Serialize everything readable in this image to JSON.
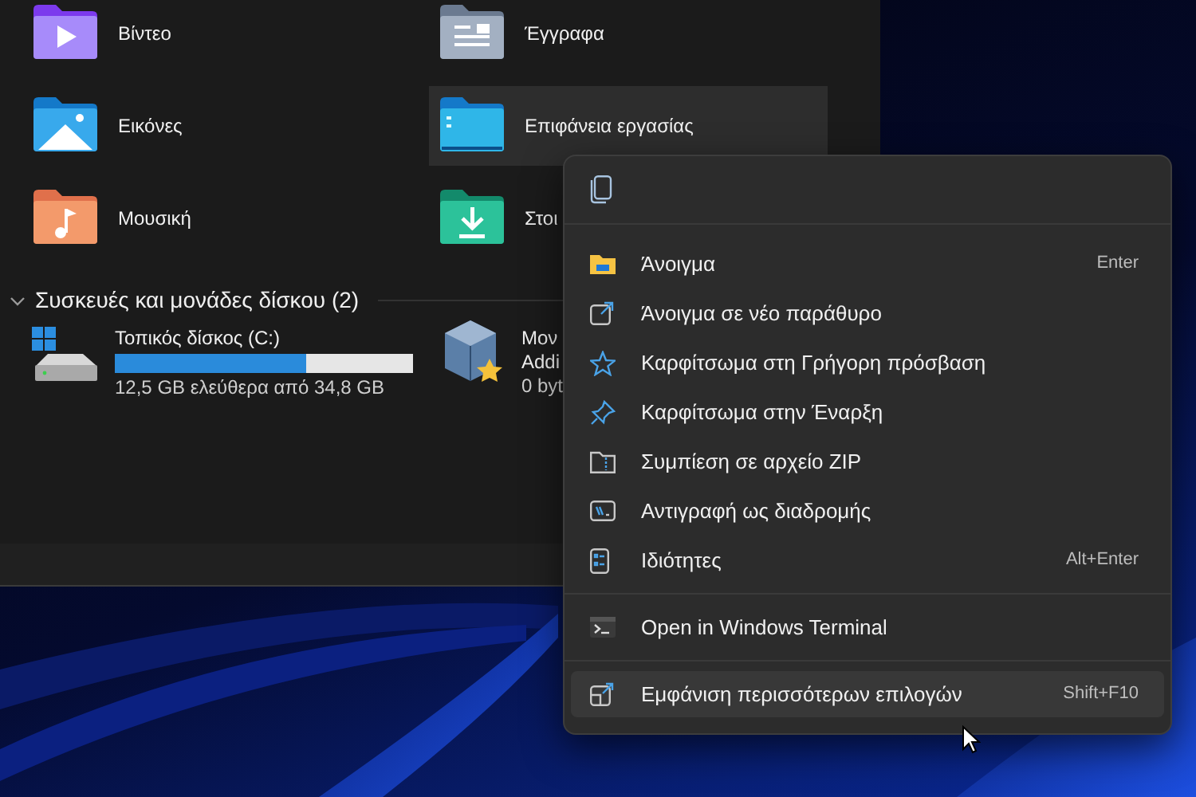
{
  "folders": [
    {
      "name": "Βίντεο",
      "selected": false
    },
    {
      "name": "Έγγραφα",
      "selected": false
    },
    {
      "name": "Εικόνες",
      "selected": false
    },
    {
      "name": "Επιφάνεια εργασίας",
      "selected": true
    },
    {
      "name": "Μουσική",
      "selected": false
    },
    {
      "name": "Στοι",
      "selected": false
    }
  ],
  "devices_section": {
    "title": "Συσκευές και μονάδες δίσκου (2)",
    "expanded": true
  },
  "drives": [
    {
      "name": "Τοπικός δίσκος (C:)",
      "level": 0.64,
      "space": "12,5 GB ελεύθερα από 34,8 GB"
    },
    {
      "name": "Μον",
      "line_2": "Addi",
      "space": "0 byt"
    }
  ],
  "context_menu": {
    "sections": [
      [
        {
          "label": "Άνοιγμα",
          "shortcut": "Enter",
          "highlighted": false
        },
        {
          "label": "Άνοιγμα σε νέο παράθυρο",
          "highlighted": false
        },
        {
          "label": "Καρφίτσωμα στη Γρήγορη πρόσβαση",
          "highlighted": false
        },
        {
          "label": "Καρφίτσωμα στην Έναρξη",
          "highlighted": false
        },
        {
          "label": "Συμπίεση σε αρχείο ZIP",
          "highlighted": false
        },
        {
          "label": "Αντιγραφή ως διαδρομής",
          "highlighted": false
        },
        {
          "label": "Ιδιότητες",
          "shortcut": "Alt+Enter",
          "highlighted": false
        }
      ],
      [
        {
          "label": "Open in Windows Terminal",
          "highlighted": false
        }
      ],
      [
        {
          "label": "Εμφάνιση περισσότερων επιλογών",
          "shortcut": "Shift+F10",
          "highlighted": true
        }
      ]
    ]
  }
}
